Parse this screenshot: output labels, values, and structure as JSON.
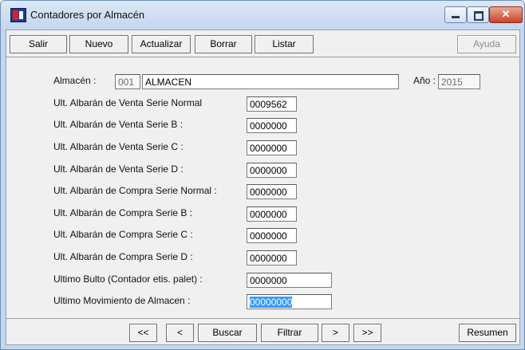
{
  "window": {
    "title": "Contadores por Almacén"
  },
  "toolbar": {
    "salir": "Salir",
    "nuevo": "Nuevo",
    "actualizar": "Actualizar",
    "borrar": "Borrar",
    "listar": "Listar",
    "ayuda": "Ayuda"
  },
  "form": {
    "almacen_label": "Almacén :",
    "almacen_code": "001",
    "almacen_name": "ALMACEN",
    "anio_label": "Año :",
    "anio_value": "2015",
    "rows": [
      {
        "label": "Ult. Albarán de Venta Serie Normal",
        "value": "0009562"
      },
      {
        "label": "Ult. Albarán de Venta Serie B :",
        "value": "0000000"
      },
      {
        "label": "Ult. Albarán de Venta Serie C :",
        "value": "0000000"
      },
      {
        "label": "Ult. Albarán de Venta Serie D :",
        "value": "0000000"
      },
      {
        "label": "Ult. Albarán de Compra Serie Normal :",
        "value": "0000000"
      },
      {
        "label": "Ult. Albarán de Compra Serie B :",
        "value": "0000000"
      },
      {
        "label": "Ult. Albarán de Compra Serie C :",
        "value": "0000000"
      },
      {
        "label": "Ult. Albarán de Compra Serie D :",
        "value": "0000000"
      },
      {
        "label": "Ultimo Bulto (Contador etis. palet) :",
        "value": "0000000"
      },
      {
        "label": "Ultimo Movimiento de Almacen :",
        "value": "00000000"
      }
    ]
  },
  "navbar": {
    "first": "<<",
    "prev": "<",
    "buscar": "Buscar",
    "filtrar": "Filtrar",
    "next": ">",
    "last": ">>",
    "resumen": "Resumen"
  }
}
